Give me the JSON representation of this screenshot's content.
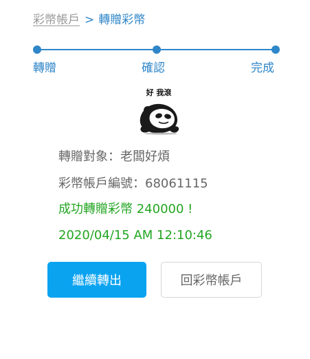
{
  "breadcrumb": {
    "parent": "彩幣帳戶",
    "separator": ">",
    "current": "轉贈彩幣"
  },
  "stepper": {
    "steps": [
      "轉贈",
      "確認",
      "完成"
    ],
    "color": "#2f86c8"
  },
  "sticker": {
    "caption": "好 我滾",
    "icon": "panda-meme-sticker"
  },
  "result": {
    "recipient_line": "轉贈對象：老闆好煩",
    "account_line": "彩幣帳戶編號：68061115",
    "success_line": "成功轉贈彩幣 240000 !",
    "timestamp": "2020/04/15 AM 12:10:46",
    "success_color": "#22a522"
  },
  "actions": {
    "continue_label": "繼續轉出",
    "back_label": "回彩幣帳戶",
    "primary_color": "#0aa3f0"
  }
}
